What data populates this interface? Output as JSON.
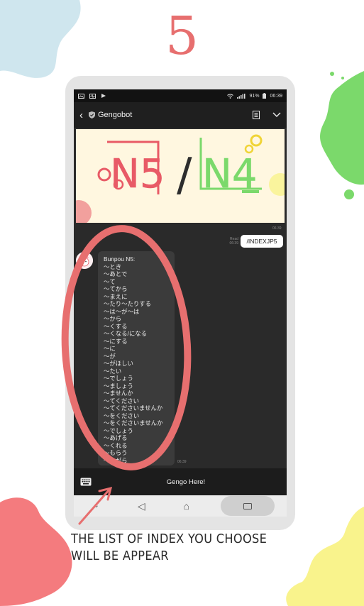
{
  "step": {
    "number": "5"
  },
  "status_bar": {
    "battery": "91%",
    "time": "06:39"
  },
  "chat_header": {
    "bot_name": "Gengobot"
  },
  "banner": {
    "left_label": "N5",
    "separator": "/",
    "right_label": "N4"
  },
  "messages": {
    "banner_time": "06:39",
    "sent": {
      "text": "/INDEXJP5",
      "read_label": "Read",
      "time": "06:39"
    },
    "received": {
      "title": "Bunpou N5:",
      "items": [
        "〜とき",
        "〜あとで",
        "〜て",
        "〜てから",
        "〜まえに",
        "〜たり〜たりする",
        "〜は〜が〜は",
        "〜から",
        "〜くする",
        "〜くなる/になる",
        "〜にする",
        "〜に",
        "〜が",
        "〜がほしい",
        "〜たい",
        "〜でしょう",
        "〜ましょう",
        "〜ませんか",
        "〜てください",
        "〜てくださいませんか",
        "〜をください",
        "〜をくださいませんか",
        "〜でしょう",
        "〜あげる",
        "〜くれる",
        "〜もらう",
        "〜ながら"
      ],
      "time": "06:39"
    }
  },
  "input_bar": {
    "placeholder": "Gengo Here!"
  },
  "caption": {
    "line1": "THE LIST OF INDEX YOU CHOOSE",
    "line2": "WILL BE APPEAR"
  },
  "colors": {
    "accent_red": "#e76f6f",
    "blob_blue": "#cfe6ee",
    "blob_green": "#7bd96b",
    "blob_yellow": "#f9f38c",
    "n4_green": "#7bd96b",
    "n5_red": "#e85a66"
  }
}
